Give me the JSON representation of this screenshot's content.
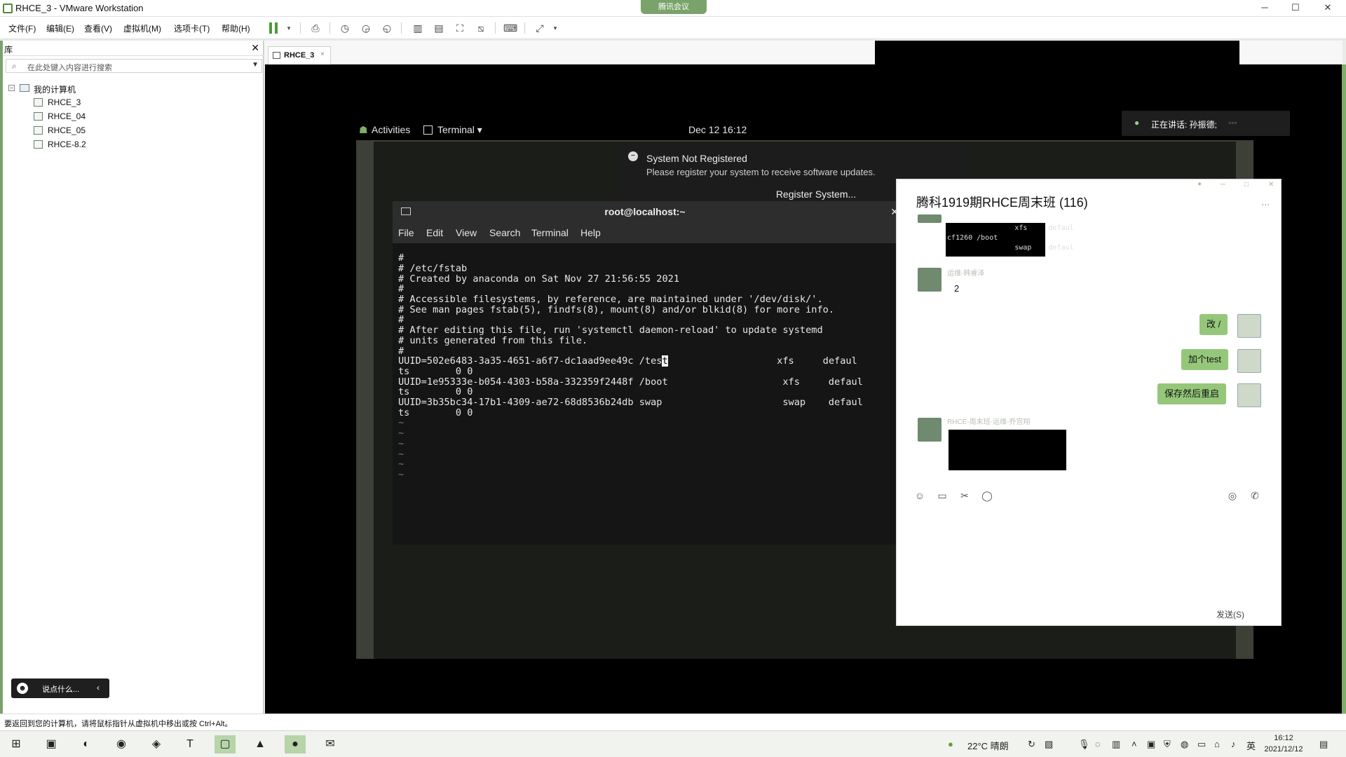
{
  "window": {
    "title": "RHCE_3 - VMware Workstation",
    "meeting_pill": "腾讯会议",
    "min": "─",
    "max": "☐",
    "close": "✕"
  },
  "menu": [
    "文件(F)",
    "编辑(E)",
    "查看(V)",
    "虚拟机(M)",
    "选项卡(T)",
    "帮助(H)"
  ],
  "library": {
    "title": "库",
    "close": "✕",
    "search_placeholder": "在此处键入内容进行搜索",
    "root": "我的计算机",
    "vms": [
      "RHCE_3",
      "RHCE_04",
      "RHCE_05",
      "RHCE-8.2"
    ]
  },
  "tab": {
    "label": "RHCE_3",
    "close": "×"
  },
  "gnome": {
    "activities": "Activities",
    "app_menu": "Terminal ▾",
    "clock": "Dec 12  16:12"
  },
  "notice": {
    "title": "System Not Registered",
    "body": "Please register your system to receive software updates.",
    "button": "Register System..."
  },
  "terminal": {
    "title": "root@localhost:~",
    "menu": [
      "File",
      "Edit",
      "View",
      "Search",
      "Terminal",
      "Help"
    ],
    "lines": [
      "#",
      "# /etc/fstab",
      "# Created by anaconda on Sat Nov 27 21:56:55 2021",
      "#",
      "# Accessible filesystems, by reference, are maintained under '/dev/disk/'.",
      "# See man pages fstab(5), findfs(8), mount(8) and/or blkid(8) for more info.",
      "#",
      "# After editing this file, run 'systemctl daemon-reload' to update systemd",
      "# units generated from this file.",
      "#",
      "UUID=502e6483-3a35-4651-a6f7-dc1aad9ee49c /tes",
      "ts        0 0",
      "UUID=1e95333e-b054-4303-b58a-332359f2448f /boot                    xfs     defaul",
      "ts        0 0",
      "UUID=3b35bc34-17b1-4309-ae72-68d8536b24db swap                     swap    defaul",
      "ts        0 0",
      "~",
      "~",
      "~",
      "~",
      "~",
      "~"
    ],
    "cursor_char": "t",
    "line10_tail": "                   xfs     defaul"
  },
  "speaking": {
    "label": "正在讲话: 孙振德;"
  },
  "chat": {
    "title": "腾科1919期RHCE周末班 (116)",
    "more": "...",
    "shot1_lines": [
      "                xfs     defaul",
      "cf1260 /boot",
      "                swap    defaul"
    ],
    "sender1": "运维-韩睿泽",
    "msg1": "2",
    "mine": [
      "改 /",
      "加个test",
      "保存然后重启"
    ],
    "sender2": "RHCE-周末班-运维-乔宫翔",
    "send": "发送(S)",
    "tools": [
      "☺",
      "▭",
      "✂",
      "◯"
    ],
    "tools_right": [
      "◎",
      "✆"
    ]
  },
  "say_box": {
    "text": "说点什么..."
  },
  "statusbar": {
    "text": "要返回到您的计算机，请将鼠标指针从虚拟机中移出或按 Ctrl+Alt。"
  },
  "taskbar": {
    "weather": "22°C  晴朗",
    "ime": "英",
    "time": "16:12",
    "date": "2021/12/12"
  }
}
